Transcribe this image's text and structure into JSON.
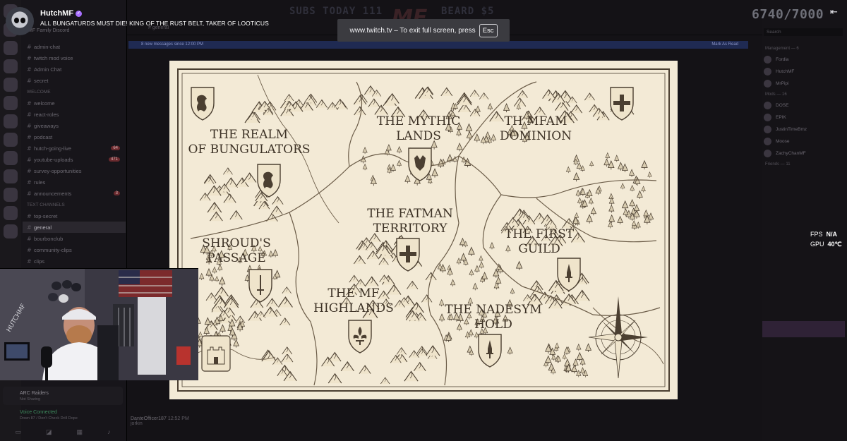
{
  "stream": {
    "streamer_name": "HutchMF",
    "title": "ALL BUNGATURDS MUST DIE! KING OF THE RUST BELT, TAKER OF LOOTICUS",
    "subs_today": "SUBS TODAY 111",
    "beard": "BEARD  $5",
    "goal_counter": "6740/7000",
    "exit_fullscreen_glyph": "⇤"
  },
  "fullscreen_toast": {
    "message": "www.twitch.tv – To exit full screen, press",
    "key": "Esc"
  },
  "overlay_stats": {
    "fps_label": "FPS",
    "fps_value": "N/A",
    "gpu_label": "GPU",
    "gpu_value": "40℃"
  },
  "map": {
    "regions": [
      {
        "line1": "THE REALM",
        "line2": "OF BUNGULATORS"
      },
      {
        "line1": "THE MYTHIC",
        "line2": "LANDS"
      },
      {
        "line1": "TH MFAM",
        "line2": "DOMINION"
      },
      {
        "line1": "THE FATMAN",
        "line2": "TERRITORY"
      },
      {
        "line1": "SHROUD'S",
        "line2": "PASSAGE"
      },
      {
        "line1": "THE FIRST",
        "line2": "GUILD"
      },
      {
        "line1": "THE MF",
        "line2": "HIGHLANDS"
      },
      {
        "line1": "THE NADESYM",
        "line2": "HOLD"
      }
    ]
  },
  "discord": {
    "guild": "MF Family Discord",
    "channel_header": "general",
    "new_messages": "8 new messages since 12:00 PM",
    "mark_read": "Mark As Read",
    "channels": [
      {
        "label": "admin-chat"
      },
      {
        "label": "twitch mod voice"
      },
      {
        "label": "Admin Chat"
      },
      {
        "label": "secret"
      },
      {
        "label": "Welcome",
        "category": true
      },
      {
        "label": "welcome"
      },
      {
        "label": "react-roles"
      },
      {
        "label": "giveaways"
      },
      {
        "label": "podcast"
      },
      {
        "label": "hutch-going-live",
        "count": "64"
      },
      {
        "label": "youtube-uploads",
        "count": "471"
      },
      {
        "label": "survey-opportunities"
      },
      {
        "label": "rules"
      },
      {
        "label": "announcements",
        "count": "3"
      },
      {
        "label": "Text Channels",
        "category": true
      },
      {
        "label": "top-secret"
      },
      {
        "label": "general"
      },
      {
        "label": "bourbonclub"
      },
      {
        "label": "community-clips"
      },
      {
        "label": "clips"
      }
    ],
    "member_search": "Search",
    "members": [
      {
        "label": "Management — 6",
        "header": true
      },
      {
        "label": "Fordia"
      },
      {
        "label": "HutchMF"
      },
      {
        "label": "MrPipi"
      },
      {
        "label": "Mods — 16",
        "header": true
      },
      {
        "label": "DOSE"
      },
      {
        "label": "EPIK"
      },
      {
        "label": "JustinTimeBmz"
      },
      {
        "label": "Moose"
      },
      {
        "label": "ZachyChanMF"
      },
      {
        "label": "Friends — 11",
        "header": true
      }
    ],
    "voice_activity": "ARC Raiders",
    "voice_activity_sub": "Not Sharing",
    "voice_connected": "Voice Connected",
    "voice_channel": "Down 87 / Don't Check Drill Dope",
    "chat_user": "DanteOfficer187",
    "chat_time": "12:52 PM",
    "chat_text": "jorkin"
  },
  "colors": {
    "parchment": "#f3ead6",
    "ink": "#3d3226",
    "accent_purple": "#a970ff"
  }
}
